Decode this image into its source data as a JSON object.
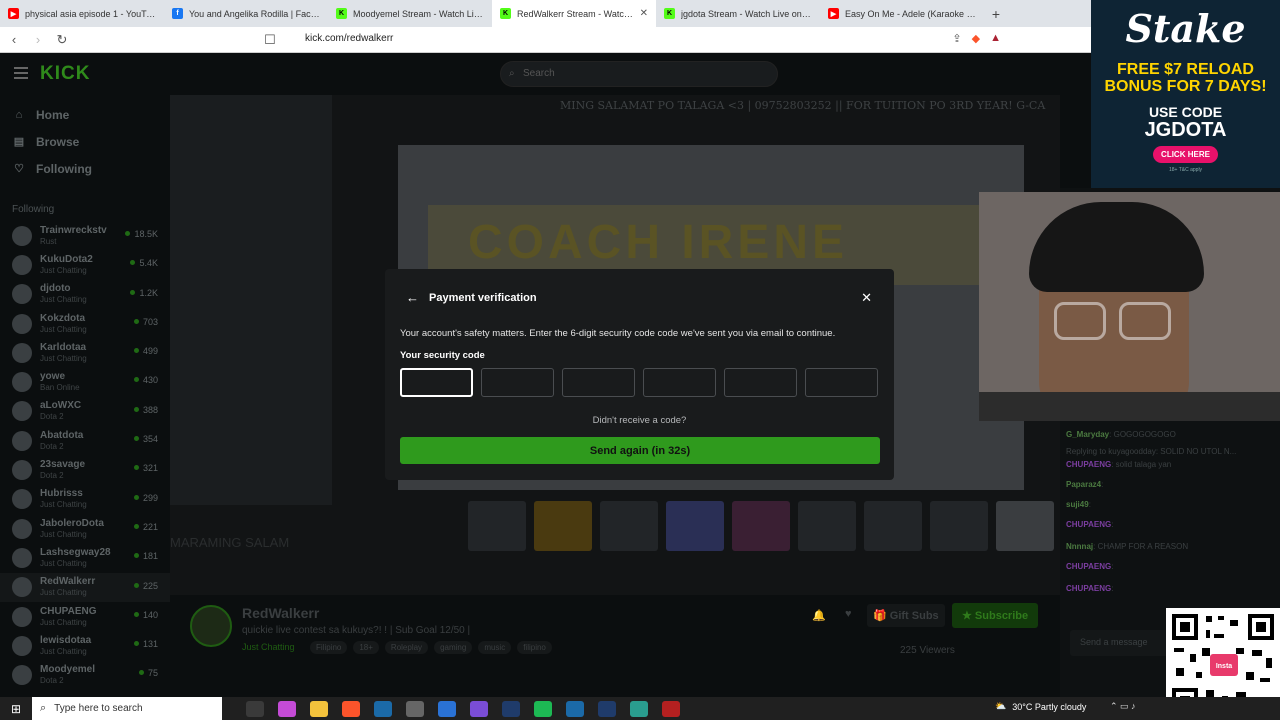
{
  "browser": {
    "tabs": [
      {
        "title": "physical asia episode 1 - YouTube",
        "color": "#ff0000",
        "active": false
      },
      {
        "title": "You and Angelika Rodilla | Facebook",
        "color": "#1877f2",
        "active": false
      },
      {
        "title": "Moodyemel Stream - Watch Live on",
        "color": "#53fc18",
        "active": false
      },
      {
        "title": "RedWalkerr Stream - Watch Live",
        "color": "#53fc18",
        "active": true
      },
      {
        "title": "jgdota Stream - Watch Live on Kick",
        "color": "#53fc18",
        "active": false
      },
      {
        "title": "Easy On Me - Adele (Karaoke Songs",
        "color": "#ff0000",
        "active": false
      }
    ],
    "new_tab": "+",
    "url": "kick.com/redwalkerr"
  },
  "ad": {
    "logo": "Stake",
    "promo": "FREE $7 RELOAD BONUS FOR 7 DAYS!",
    "use_code": "USE CODE",
    "code": "JGDOTA",
    "cta": "CLICK HERE",
    "fine": "18+ T&C apply"
  },
  "kick": {
    "search_placeholder": "Search",
    "nav": [
      {
        "label": "Home",
        "icon": "home-icon"
      },
      {
        "label": "Browse",
        "icon": "browse-icon"
      },
      {
        "label": "Following",
        "icon": "heart-icon"
      }
    ],
    "following_title": "Following",
    "channels": [
      {
        "name": "Trainwreckstv",
        "category": "Rust",
        "viewers": "18.5K"
      },
      {
        "name": "KukuDota2",
        "category": "Just Chatting",
        "viewers": "5.4K"
      },
      {
        "name": "djdoto",
        "category": "Just Chatting",
        "viewers": "1.2K"
      },
      {
        "name": "Kokzdota",
        "category": "Just Chatting",
        "viewers": "703"
      },
      {
        "name": "Karldotaa",
        "category": "Just Chatting",
        "viewers": "499"
      },
      {
        "name": "yowe",
        "category": "Ban Online",
        "viewers": "430"
      },
      {
        "name": "aLoWXC",
        "category": "Dota 2",
        "viewers": "388"
      },
      {
        "name": "Abatdota",
        "category": "Dota 2",
        "viewers": "354"
      },
      {
        "name": "23savage",
        "category": "Dota 2",
        "viewers": "321"
      },
      {
        "name": "Hubrisss",
        "category": "Just Chatting",
        "viewers": "299"
      },
      {
        "name": "JaboleroDota",
        "category": "Just Chatting",
        "viewers": "221"
      },
      {
        "name": "Lashsegway28",
        "category": "Just Chatting",
        "viewers": "181"
      },
      {
        "name": "RedWalkerr",
        "category": "Just Chatting",
        "viewers": "225"
      },
      {
        "name": "CHUPAENG",
        "category": "Just Chatting",
        "viewers": "140"
      },
      {
        "name": "lewisdotaa",
        "category": "Just Chatting",
        "viewers": "131"
      },
      {
        "name": "Moodyemel",
        "category": "Dota 2",
        "viewers": "75"
      }
    ],
    "marquee": "MING SALAMAT PO TALAGA <3 | 09752803252 || FOR TUITION PO 3RD YEAR! G-CA",
    "video_text": "COACH IRENE",
    "overlay_left_text": "MARAMING SALAM",
    "stream": {
      "name": "RedWalkerr",
      "title": "quickie live contest sa kukuys?! ! | Sub Goal 12/50 |",
      "category": "Just Chatting",
      "tags": [
        "Filipino",
        "18+",
        "Roleplay",
        "gaming",
        "music",
        "filipino"
      ],
      "gift_label": "Gift Subs",
      "subscribe_label": "Subscribe",
      "viewers": "225 Viewers"
    },
    "chat": [
      {
        "user": "G_Maryday",
        "msg": "GOGOGOGOGO"
      },
      {
        "user": "",
        "msg": "Replying to kuyagoodday: SOLID NO UTOL N..."
      },
      {
        "user": "CHUPAENG",
        "msg": "solid talaga yan"
      },
      {
        "user": "Paparaz4",
        "msg": ""
      },
      {
        "user": "suji49",
        "msg": ""
      },
      {
        "user": "CHUPAENG",
        "msg": ""
      },
      {
        "user": "Nnnnaj",
        "msg": "CHAMP FOR A REASON"
      },
      {
        "user": "CHUPAENG",
        "msg": ""
      },
      {
        "user": "CHUPAENG",
        "msg": ""
      }
    ],
    "chat_placeholder": "Send a message"
  },
  "modal": {
    "title": "Payment verification",
    "description": "Your account's safety matters. Enter the 6-digit security code code we've sent you via email to continue.",
    "code_label": "Your security code",
    "code_digits": [
      "",
      "",
      "",
      "",
      "",
      ""
    ],
    "resend_prompt": "Didn't receive a code?",
    "send_again": "Send again (in 32s)"
  },
  "taskbar": {
    "search_placeholder": "Type here to search",
    "weather": "30°C  Partly cloudy"
  }
}
